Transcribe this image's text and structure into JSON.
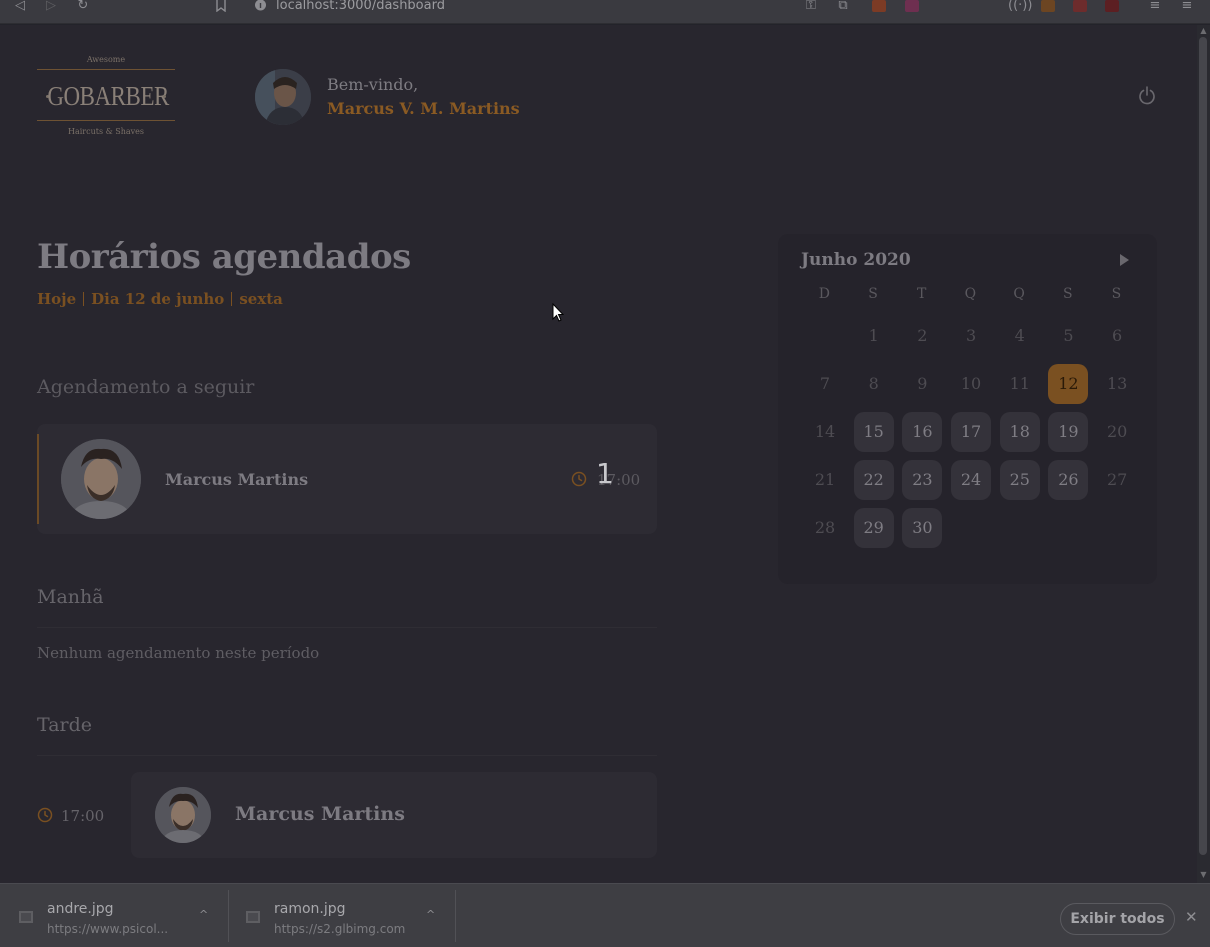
{
  "browser": {
    "url": "localhost:3000/dashboard"
  },
  "header": {
    "logo": {
      "top_text": "Awesome",
      "name": "GOBARBER",
      "bottom_text": "Haircuts & Shaves"
    },
    "welcome": "Bem-vindo,",
    "user_name": "Marcus V. M. Martins"
  },
  "schedule": {
    "title": "Horários agendados",
    "subtitle": {
      "today": "Hoje",
      "date": "Dia 12 de junho",
      "weekday": "sexta"
    },
    "next_label": "Agendamento a seguir",
    "next_appointment": {
      "name": "Marcus Martins",
      "time": "17:00"
    },
    "morning": {
      "label": "Manhã",
      "empty": "Nenhum agendamento neste período"
    },
    "afternoon": {
      "label": "Tarde",
      "appointments": [
        {
          "time": "17:00",
          "name": "Marcus Martins"
        }
      ]
    }
  },
  "keystroke_overlay": "1",
  "calendar": {
    "month": "Junho 2020",
    "weekdays": [
      "D",
      "S",
      "T",
      "Q",
      "Q",
      "S",
      "S"
    ],
    "weeks": [
      [
        "",
        "1",
        "2",
        "3",
        "4",
        "5",
        "6"
      ],
      [
        "7",
        "8",
        "9",
        "10",
        "11",
        "12",
        "13"
      ],
      [
        "14",
        "15",
        "16",
        "17",
        "18",
        "19",
        "20"
      ],
      [
        "21",
        "22",
        "23",
        "24",
        "25",
        "26",
        "27"
      ],
      [
        "28",
        "29",
        "30",
        "",
        "",
        "",
        ""
      ]
    ],
    "selected_day": "12",
    "available_days": [
      "15",
      "16",
      "17",
      "18",
      "19",
      "22",
      "23",
      "24",
      "25",
      "26",
      "29",
      "30"
    ],
    "accent_color": "#7a5021"
  },
  "downloads": {
    "items": [
      {
        "name": "andre.jpg",
        "url": "https://www.psicol..."
      },
      {
        "name": "ramon.jpg",
        "url": "https://s2.glbimg.com"
      }
    ],
    "show_all": "Exibir todos"
  }
}
